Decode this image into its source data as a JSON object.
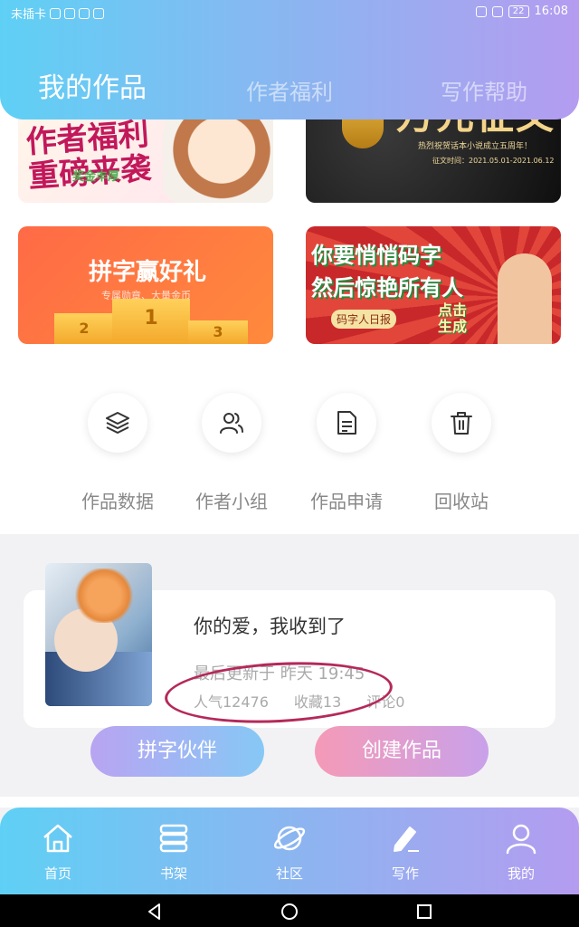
{
  "status_bar": {
    "carrier": "未插卡",
    "battery": "22",
    "time": "16:08"
  },
  "tabs": [
    {
      "label": "我的作品",
      "active": true
    },
    {
      "label": "作者福利",
      "active": false
    },
    {
      "label": "写作帮助",
      "active": false
    }
  ],
  "banners": {
    "b1": {
      "text_line1": "作者福利",
      "text_line2": "重磅来袭",
      "tag": "奖金丰厚"
    },
    "b2": {
      "text": "万元征文",
      "sub": "热烈祝贺话本小说成立五周年！",
      "date": "征文时间：2021.05.01-2021.06.12"
    },
    "b3": {
      "text": "拼字赢好礼",
      "sub": "专属勋章、大量金币",
      "podium": [
        "2",
        "1",
        "3"
      ]
    },
    "b4": {
      "text_line1": "你要悄悄码字",
      "text_line2": "然后惊艳所有人",
      "tag": "码字人日报",
      "click_line1": "点击",
      "click_line2": "生成"
    }
  },
  "quick_actions": [
    {
      "label": "作品数据",
      "icon": "layers-icon"
    },
    {
      "label": "作者小组",
      "icon": "group-icon"
    },
    {
      "label": "作品申请",
      "icon": "document-icon"
    },
    {
      "label": "回收站",
      "icon": "trash-icon"
    }
  ],
  "work": {
    "title": "你的爱，我收到了",
    "updated": "最后更新于 昨天 19:45",
    "popularity": "人气12476",
    "favorites": "收藏13",
    "comments": "评论0"
  },
  "buttons": {
    "partner": "拼字伙伴",
    "create": "创建作品"
  },
  "bottom_nav": [
    {
      "label": "首页",
      "icon": "home-icon"
    },
    {
      "label": "书架",
      "icon": "bookshelf-icon"
    },
    {
      "label": "社区",
      "icon": "planet-icon"
    },
    {
      "label": "写作",
      "icon": "pen-icon",
      "active": true
    },
    {
      "label": "我的",
      "icon": "user-icon"
    }
  ],
  "colors": {
    "header_start": "#5fd0f5",
    "header_end": "#b49cf0",
    "annotation": "#b5295a"
  }
}
